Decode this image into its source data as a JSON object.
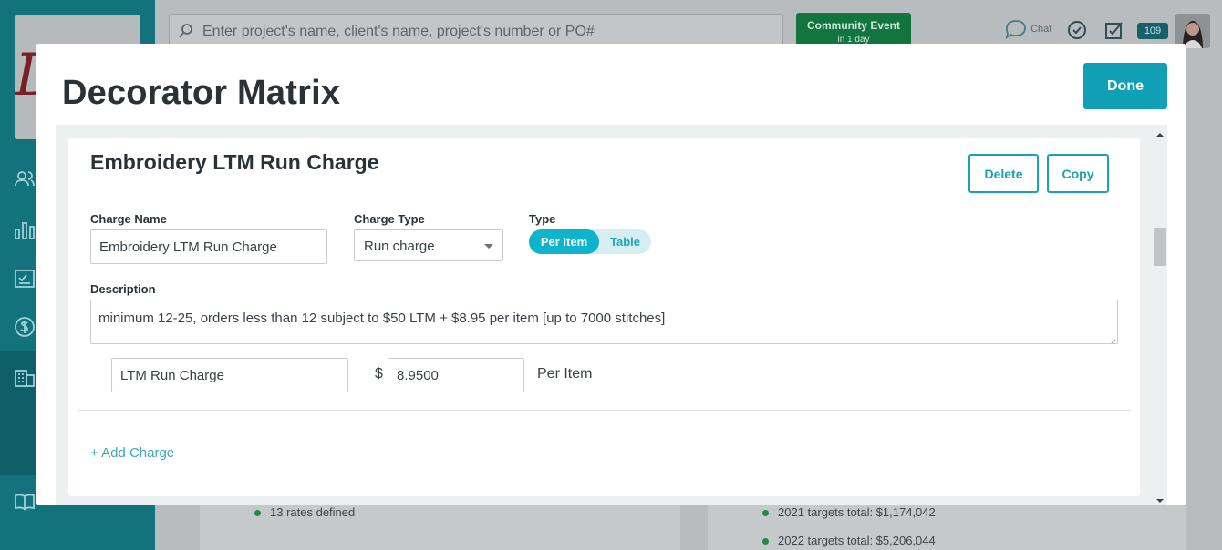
{
  "background": {
    "search_placeholder": "Enter project's name, client's name, project's number or PO#",
    "event_badge": {
      "title": "Community Event",
      "subtitle": "in 1 day"
    },
    "chat_label": "Chat",
    "notification_count": "109",
    "left_card": {
      "bullet": "13 rates defined"
    },
    "right_card": {
      "bullets": [
        "2021 targets total: $1,174,042",
        "2022 targets total: $5,206,044"
      ]
    }
  },
  "modal": {
    "title": "Decorator Matrix",
    "done_label": "Done",
    "charge": {
      "title": "Embroidery LTM Run Charge",
      "delete_label": "Delete",
      "copy_label": "Copy",
      "charge_name_label": "Charge Name",
      "charge_name_value": "Embroidery LTM Run Charge",
      "charge_type_label": "Charge Type",
      "charge_type_value": "Run charge",
      "type_label": "Type",
      "type_options": [
        "Per Item",
        "Table"
      ],
      "description_label": "Description",
      "description_value": "minimum 12-25, orders less than 12 subject to $50 LTM + $8.95 per item [up to 7000 stitches]",
      "line_name_value": "LTM Run Charge",
      "currency_symbol": "$",
      "line_price_value": "8.9500",
      "unit_label": "Per Item"
    },
    "add_charge_label": "+ Add Charge"
  },
  "colors": {
    "accent": "#119fb5",
    "toggle_on": "#0fb4cc",
    "event_green": "#12743e",
    "sidebar": "#12737d"
  }
}
